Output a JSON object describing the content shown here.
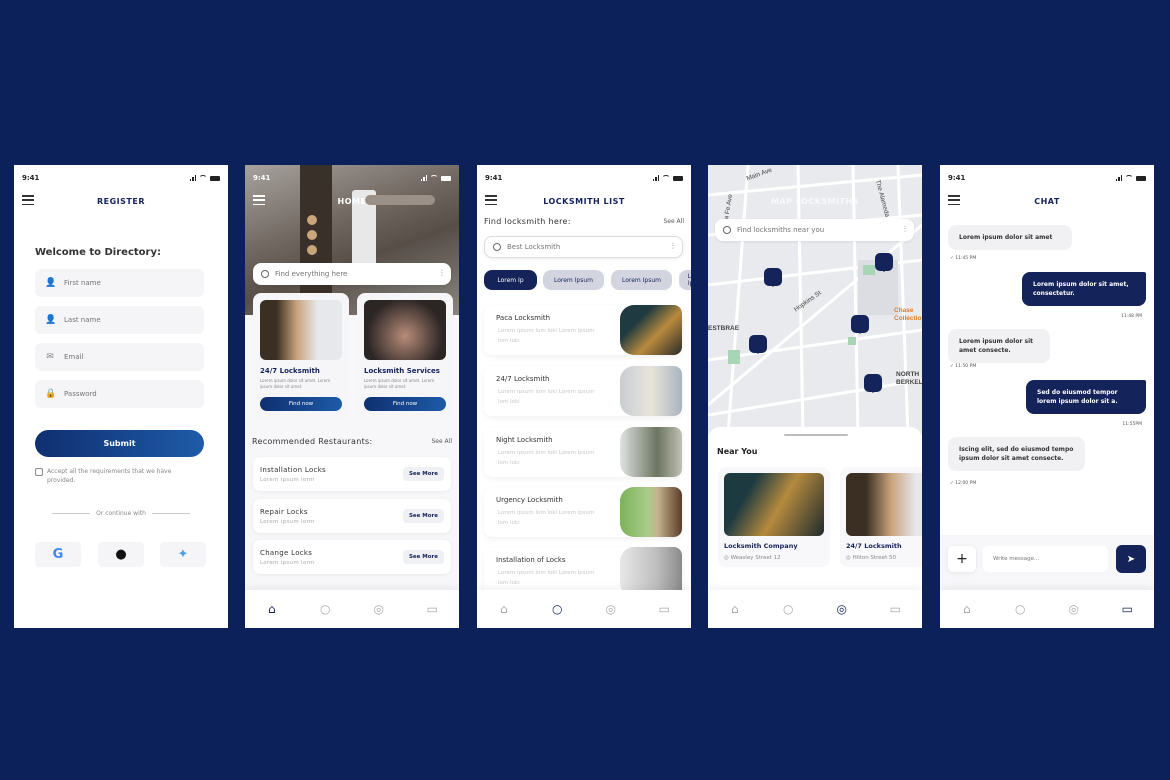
{
  "status_time": "9:41",
  "register": {
    "title": "REGISTER",
    "welcome": "Welcome to Directory:",
    "fields": [
      {
        "placeholder": "First name",
        "icon": "user-icon"
      },
      {
        "placeholder": "Last name",
        "icon": "user-icon"
      },
      {
        "placeholder": "Email",
        "icon": "mail-icon"
      },
      {
        "placeholder": "Password",
        "icon": "lock-icon"
      }
    ],
    "submit_label": "Submit",
    "accept_text": "Accept all the requirements that we have provided.",
    "or_continue": "Or continue with",
    "social": [
      {
        "name": "google-icon",
        "glyph": "G",
        "color": "#4285f4"
      },
      {
        "name": "apple-icon",
        "glyph": "",
        "color": "#111111"
      },
      {
        "name": "twitter-icon",
        "glyph": "🐦",
        "color": "#4aa3e8"
      }
    ]
  },
  "home": {
    "title": "HOME",
    "search_placeholder": "Find everything here",
    "cards": [
      {
        "title": "24/7 Locksmith",
        "desc": "Lorem ipsum dolor sit amet. Lorem ipsum dolor sit amet.",
        "button": "Find now"
      },
      {
        "title": "Locksmith Services",
        "desc": "Lorem ipsum dolor sit amet. Lorem ipsum dolor sit amet.",
        "button": "Find now"
      }
    ],
    "section_title": "Recommended Restaurants:",
    "see_all": "See All",
    "rows": [
      {
        "title": "Installation Locks",
        "sub": "Lorem ipsum lorm",
        "button": "See More"
      },
      {
        "title": "Repair Locks",
        "sub": "Lorem ipsum lorm",
        "button": "See More"
      },
      {
        "title": "Change Locks",
        "sub": "Lorem ipsum lorm",
        "button": "See More"
      }
    ]
  },
  "list": {
    "title": "LOCKSMITH LIST",
    "section_title": "Find locksmith here:",
    "see_all": "See All",
    "search_placeholder": "Best Locksmith",
    "chips": [
      "Lorem Ip",
      "Lorem Ipsum",
      "Lorem Ipsum",
      "Lorem Ipsum"
    ],
    "items": [
      {
        "title": "Paca  Locksmith",
        "desc": "Lorem ipsum lom loki Lorem ipsum lom loki"
      },
      {
        "title": "24/7 Locksmith",
        "desc": "Lorem ipsum lom loki Lorem ipsum lom loki"
      },
      {
        "title": "Night Locksmith",
        "desc": "Lorem ipsum lom loki Lorem ipsum lom loki"
      },
      {
        "title": "Urgency Locksmith",
        "desc": "Lorem ipsum lom loki Lorem ipsum lom loki"
      },
      {
        "title": "Installation of Locks",
        "desc": "Lorem ipsum lom loki Lorem ipsum lom loki"
      }
    ]
  },
  "map": {
    "title": "MAP LOCKSMITHS",
    "search_placeholder": "Find locksmiths near you",
    "labels": [
      "Main Ave",
      "Santa Fe Ave",
      "The Alameda",
      "Hopkins St",
      "ESTBRAE",
      "NORTH BERKELEY",
      "Chase Collection"
    ],
    "near_title": "Near You",
    "places": [
      {
        "name": "Locksmith Company",
        "address": "Weasley Street 12"
      },
      {
        "name": "24/7 Locksmith",
        "address": "Hilton Street 50"
      }
    ]
  },
  "chat": {
    "title": "CHAT",
    "messages": [
      {
        "dir": "in",
        "text": "Lorem ipsum dolor sit amet",
        "time": "11:45 PM"
      },
      {
        "dir": "out",
        "text": "Lorem ipsum dolor sit amet, consectetur.",
        "time": "11:48 PM"
      },
      {
        "dir": "in",
        "text": "Lorem ipsum dolor sit amet consecte.",
        "time": "11:50 PM"
      },
      {
        "dir": "out",
        "text": "Sed do eiusmod tempor lorem ipsum dolor sit a.",
        "time": "11:55PM"
      },
      {
        "dir": "in",
        "text": "Iscing elit, sed do eiusmod tempo ipsum dolor sit amet consecte.",
        "time": "12:00 PM"
      }
    ],
    "input_placeholder": "Write message..."
  },
  "nav": {
    "items": [
      {
        "name": "home",
        "glyph": "⌂"
      },
      {
        "name": "search",
        "glyph": "○"
      },
      {
        "name": "location",
        "glyph": "◎"
      },
      {
        "name": "chat",
        "glyph": "▭"
      }
    ]
  },
  "colors": {
    "background": "#0c215a",
    "primary": "#14235a",
    "accent": "#1e5ba8"
  }
}
